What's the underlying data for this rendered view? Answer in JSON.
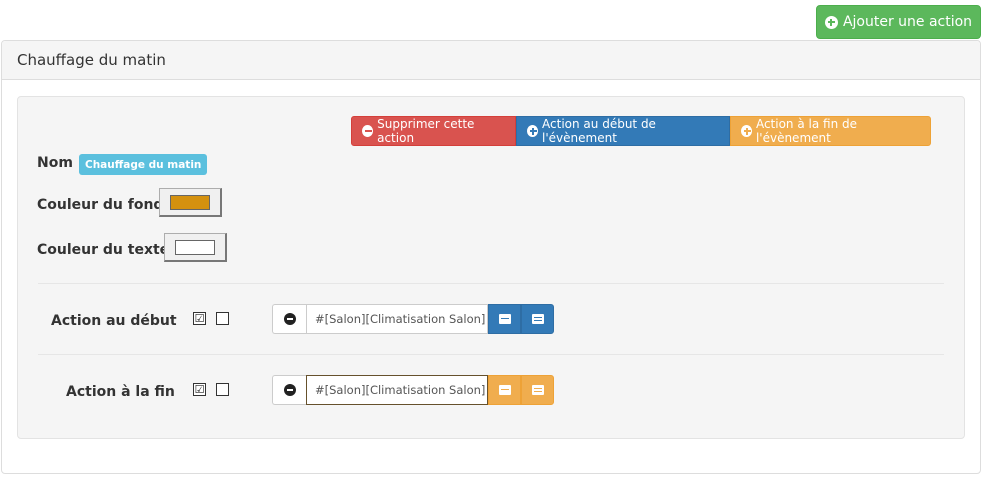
{
  "toolbar": {
    "add_action_label": "Ajouter une action"
  },
  "panel": {
    "title": "Chauffage du matin"
  },
  "actions": {
    "delete_label": "Supprimer cette action",
    "start_label": "Action au début de l'évènement",
    "end_label": "Action à la fin de l'évènement"
  },
  "form": {
    "name_label": "Nom",
    "name_value": "Chauffage du matin",
    "bg_color_label": "Couleur du fond",
    "bg_color": "#d4910f",
    "text_color_label": "Couleur du texte",
    "text_color": "#ffffff"
  },
  "start_action": {
    "label": "Action au début",
    "checkbox1": "☑",
    "checkbox2": "",
    "command": "#[Salon][Climatisation Salon]"
  },
  "end_action": {
    "label": "Action à la fin",
    "checkbox1": "☑",
    "checkbox2": "",
    "command": "#[Salon][Climatisation Salon]"
  },
  "colors": {
    "success": "#5cb85c",
    "danger": "#d9534f",
    "primary": "#337ab7",
    "warning": "#f0ad4e",
    "info": "#5bc0de"
  },
  "icons": {
    "add": "plus-circle-icon",
    "delete": "minus-circle-icon",
    "list": "list-icon",
    "form": "form-icon"
  }
}
